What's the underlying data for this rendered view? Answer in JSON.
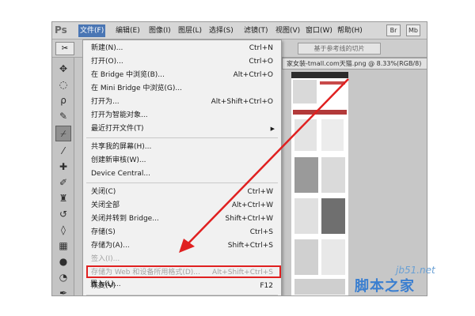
{
  "app": {
    "logo": "Ps"
  },
  "menubar": {
    "items": [
      "文件(F)",
      "编辑(E)",
      "图像(I)",
      "图层(L)",
      "选择(S)",
      "滤镜(T)",
      "视图(V)",
      "窗口(W)",
      "帮助(H)"
    ],
    "right_buttons": [
      "Br",
      "Mb"
    ]
  },
  "options_bar": {
    "slice_button": "基于参考线的切片"
  },
  "document": {
    "tab_title": "家女装-tmall.com天猫.png @ 8.33%(RGB/8)"
  },
  "file_menu": {
    "items": [
      {
        "label": "新建(N)...",
        "shortcut": "Ctrl+N"
      },
      {
        "label": "打开(O)...",
        "shortcut": "Ctrl+O"
      },
      {
        "label": "在 Bridge 中浏览(B)...",
        "shortcut": "Alt+Ctrl+O"
      },
      {
        "label": "在 Mini Bridge 中浏览(G)...",
        "shortcut": ""
      },
      {
        "label": "打开为...",
        "shortcut": "Alt+Shift+Ctrl+O"
      },
      {
        "label": "打开为智能对象...",
        "shortcut": ""
      },
      {
        "label": "最近打开文件(T)",
        "shortcut": ""
      },
      {
        "label": "共享我的屏幕(H)...",
        "shortcut": ""
      },
      {
        "label": "创建新审核(W)...",
        "shortcut": ""
      },
      {
        "label": "Device Central...",
        "shortcut": ""
      },
      {
        "label": "关闭(C)",
        "shortcut": "Ctrl+W"
      },
      {
        "label": "关闭全部",
        "shortcut": "Alt+Ctrl+W"
      },
      {
        "label": "关闭并转到 Bridge...",
        "shortcut": "Shift+Ctrl+W"
      },
      {
        "label": "存储(S)",
        "shortcut": "Ctrl+S"
      },
      {
        "label": "存储为(A)...",
        "shortcut": "Shift+Ctrl+S"
      },
      {
        "label": "签入(I)...",
        "shortcut": ""
      },
      {
        "label": "存储为 Web 和设备所用格式(D)...",
        "shortcut": "Alt+Shift+Ctrl+S"
      },
      {
        "label": "恢复(V)",
        "shortcut": "F12"
      },
      {
        "label": "置入(L)...",
        "shortcut": ""
      }
    ]
  },
  "watermark": {
    "domain": "jb51.net",
    "name": "脚本之家"
  },
  "colors": {
    "highlight": "#e02020",
    "menu_active": "#4a76b4",
    "watermark": "#3b7fd0"
  }
}
